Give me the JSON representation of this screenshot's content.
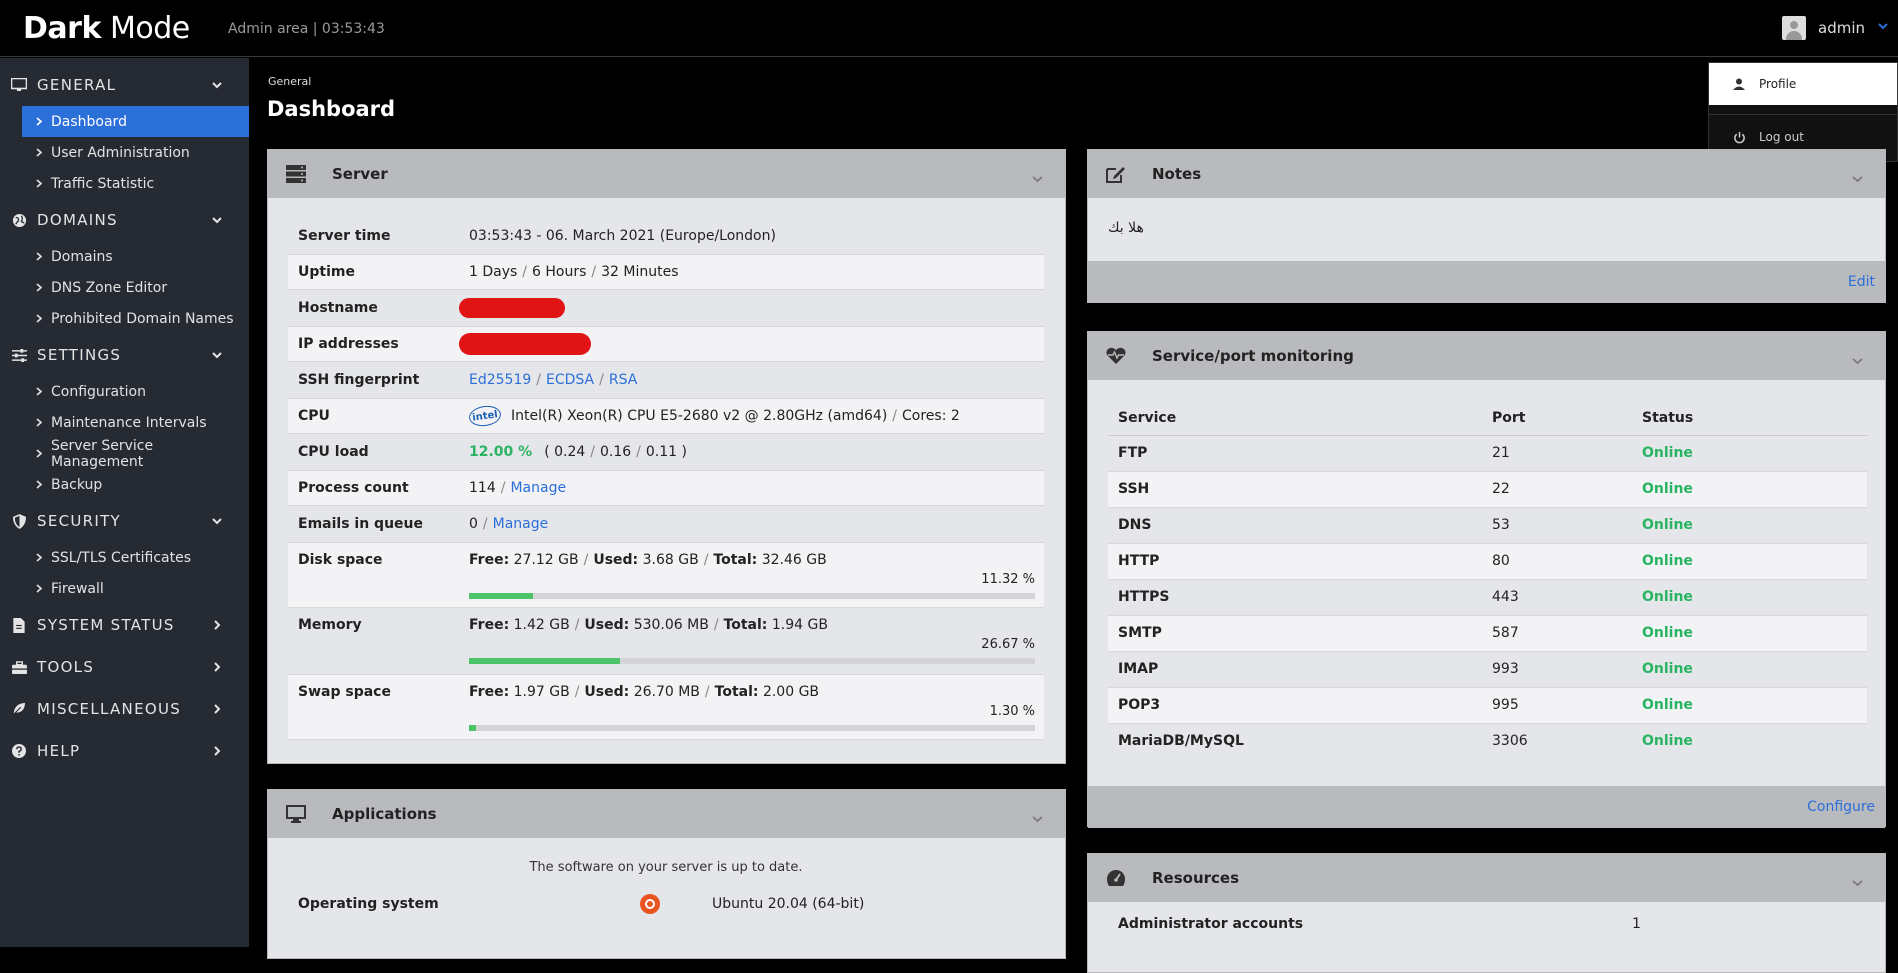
{
  "header": {
    "brand_bold": "Dark",
    "brand_rest": "Mode",
    "subtitle": "Admin area | 03:53:43",
    "user": "admin"
  },
  "user_dropdown": {
    "profile": "Profile",
    "logout": "Log out"
  },
  "sidebar": {
    "general": {
      "label": "GENERAL",
      "items": [
        "Dashboard",
        "User Administration",
        "Traffic Statistic"
      ]
    },
    "domains": {
      "label": "DOMAINS",
      "items": [
        "Domains",
        "DNS Zone Editor",
        "Prohibited Domain Names"
      ]
    },
    "settings": {
      "label": "SETTINGS",
      "items": [
        "Configuration",
        "Maintenance Intervals",
        "Server Service Management",
        "Backup"
      ]
    },
    "security": {
      "label": "SECURITY",
      "items": [
        "SSL/TLS Certificates",
        "Firewall"
      ]
    },
    "system_status": "SYSTEM STATUS",
    "tools": "TOOLS",
    "misc": "MISCELLANEOUS",
    "help": "HELP"
  },
  "breadcrumb": "General",
  "page_title": "Dashboard",
  "server": {
    "title": "Server",
    "server_time_label": "Server time",
    "server_time": "03:53:43 - 06. March 2021 (Europe/London)",
    "uptime_label": "Uptime",
    "uptime_days": "1 Days",
    "uptime_hours": "6 Hours",
    "uptime_minutes": "32 Minutes",
    "hostname_label": "Hostname",
    "ip_label": "IP addresses",
    "ssh_label": "SSH fingerprint",
    "ssh_1": "Ed25519",
    "ssh_2": "ECDSA",
    "ssh_3": "RSA",
    "cpu_label": "CPU",
    "cpu_logo": "intel",
    "cpu_value": "Intel(R) Xeon(R) CPU E5-2680 v2 @ 2.80GHz (amd64)",
    "cpu_cores": "Cores: 2",
    "cpuload_label": "CPU load",
    "cpuload_pct": "12.00 %",
    "cpuload_open": "( 0.24",
    "cpuload_mid": "0.16",
    "cpuload_close": "0.11 )",
    "proc_label": "Process count",
    "proc_value": "114",
    "manage": "Manage",
    "emails_label": "Emails in queue",
    "emails_value": "0",
    "free_lbl": "Free:",
    "used_lbl": "Used:",
    "total_lbl": "Total:",
    "disk_label": "Disk space",
    "disk_free": "27.12 GB",
    "disk_used": "3.68 GB",
    "disk_total": "32.46 GB",
    "disk_pct": "11.32 %",
    "disk_fraction": 0.1132,
    "mem_label": "Memory",
    "mem_free": "1.42 GB",
    "mem_used": "530.06 MB",
    "mem_total": "1.94 GB",
    "mem_pct": "26.67 %",
    "mem_fraction": 0.2667,
    "swap_label": "Swap space",
    "swap_free": "1.97 GB",
    "swap_used": "26.70 MB",
    "swap_total": "2.00 GB",
    "swap_pct": "1.30 %",
    "swap_fraction": 0.013
  },
  "applications": {
    "title": "Applications",
    "uptodate": "The software on your server is up to date.",
    "os_label": "Operating system",
    "os_value": "Ubuntu 20.04 (64-bit)"
  },
  "notes": {
    "title": "Notes",
    "text": "هلا بك",
    "edit": "Edit"
  },
  "monitoring": {
    "title": "Service/port monitoring",
    "col_service": "Service",
    "col_port": "Port",
    "col_status": "Status",
    "rows": [
      {
        "service": "FTP",
        "port": "21",
        "status": "Online"
      },
      {
        "service": "SSH",
        "port": "22",
        "status": "Online"
      },
      {
        "service": "DNS",
        "port": "53",
        "status": "Online"
      },
      {
        "service": "HTTP",
        "port": "80",
        "status": "Online"
      },
      {
        "service": "HTTPS",
        "port": "443",
        "status": "Online"
      },
      {
        "service": "SMTP",
        "port": "587",
        "status": "Online"
      },
      {
        "service": "IMAP",
        "port": "993",
        "status": "Online"
      },
      {
        "service": "POP3",
        "port": "995",
        "status": "Online"
      },
      {
        "service": "MariaDB/MySQL",
        "port": "3306",
        "status": "Online"
      }
    ],
    "configure": "Configure"
  },
  "resources": {
    "title": "Resources",
    "admin_label": "Administrator accounts",
    "admin_value": "1"
  },
  "colors": {
    "accent": "#2b6fd9",
    "online": "#28b463",
    "sidebar": "#262a33"
  }
}
